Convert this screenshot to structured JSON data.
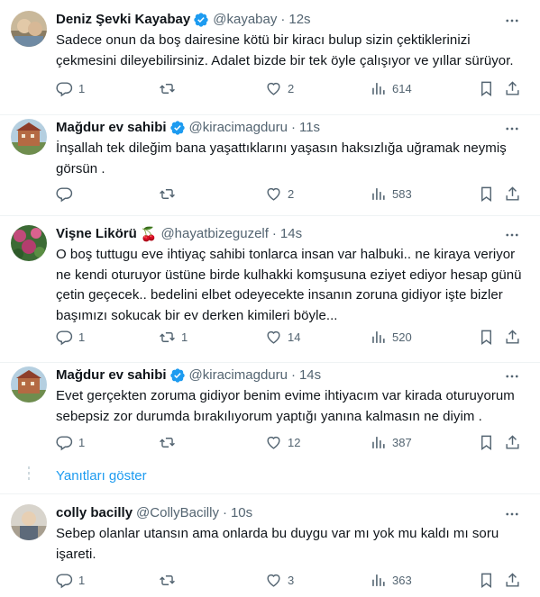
{
  "tweets": [
    {
      "name": "Deniz Şevki Kayabay",
      "verified": true,
      "handle": "@kayabay",
      "time": "12s",
      "emoji": "",
      "text": "Sadece onun da boş dairesine kötü bir kiracı bulup sizin çektiklerinizi çekmesini dileyebilirsiniz. Adalet bizde bir tek öyle çalışıyor ve yıllar sürüyor.",
      "replies": "1",
      "retweets": "",
      "likes": "2",
      "views": "614"
    },
    {
      "name": "Mağdur ev sahibi",
      "verified": true,
      "handle": "@kiracimagduru",
      "time": "11s",
      "emoji": "",
      "text": "İnşallah tek dileğim bana yaşattıklarını yaşasın haksızlığa uğramak neymiş görsün .",
      "replies": "",
      "retweets": "",
      "likes": "2",
      "views": "583"
    },
    {
      "name": "Vişne Likörü",
      "verified": false,
      "handle": "@hayatbizeguzelf",
      "time": "14s",
      "emoji": "🍒",
      "text": "O boş tuttugu eve ihtiyaç sahibi tonlarca insan var halbuki.. ne kiraya veriyor ne kendi oturuyor üstüne birde kulhakki komşusuna eziyet ediyor hesap günü çetin geçecek.. bedelini elbet odeyecekte insanın zoruna gidiyor işte bizler başımızı sokucak bir ev derken kimileri böyle...",
      "replies": "1",
      "retweets": "1",
      "likes": "14",
      "views": "520"
    },
    {
      "name": "Mağdur ev sahibi",
      "verified": true,
      "handle": "@kiracimagduru",
      "time": "14s",
      "emoji": "",
      "text": "Evet gerçekten zoruma gidiyor benim evime ihtiyacım var kirada oturuyorum sebepsiz zor durumda bırakılıyorum yaptığı yanına kalmasın ne diyim .",
      "replies": "1",
      "retweets": "",
      "likes": "12",
      "views": "387"
    },
    {
      "name": "colly bacilly",
      "verified": false,
      "handle": "@CollyBacilly",
      "time": "10s",
      "emoji": "",
      "text": "Sebep olanlar utansın ama onlarda bu duygu var mı yok mu kaldı mı soru işareti.",
      "replies": "1",
      "retweets": "",
      "likes": "3",
      "views": "363"
    }
  ],
  "show_replies_label": "Yanıtları göster",
  "colors": {
    "accent": "#1d9bf0",
    "muted": "#536471",
    "text": "#0f1419",
    "divider": "#eff3f4"
  }
}
